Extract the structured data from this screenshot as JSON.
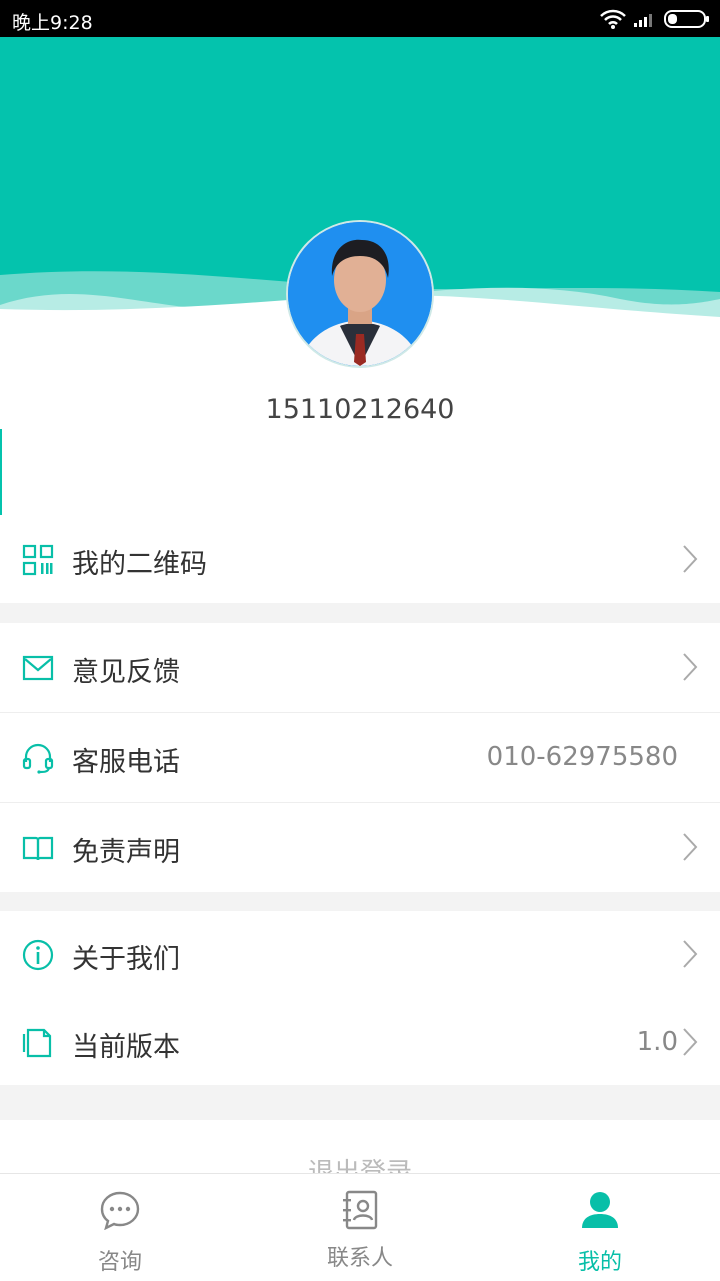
{
  "status_bar": {
    "time": "晚上9:28"
  },
  "profile": {
    "phone": "15110212640"
  },
  "menu": {
    "qrcode": {
      "label": "我的二维码",
      "icon": "qrcode-icon"
    },
    "feedback": {
      "label": "意见反馈",
      "icon": "mail-icon"
    },
    "service": {
      "label": "客服电话",
      "value": "010-62975580",
      "icon": "headset-icon"
    },
    "disclaimer": {
      "label": "免责声明",
      "icon": "book-icon"
    },
    "about": {
      "label": "关于我们",
      "icon": "info-icon"
    },
    "version": {
      "label": "当前版本",
      "value": "1.0",
      "icon": "document-icon"
    }
  },
  "logout": {
    "label": "退出登录"
  },
  "tabs": [
    {
      "label": "咨询",
      "icon": "chat-icon"
    },
    {
      "label": "联系人",
      "icon": "contacts-icon"
    },
    {
      "label": "我的",
      "icon": "user-icon",
      "active": true
    }
  ],
  "colors": {
    "accent": "#08bfa8",
    "header": "#04c3ad"
  }
}
